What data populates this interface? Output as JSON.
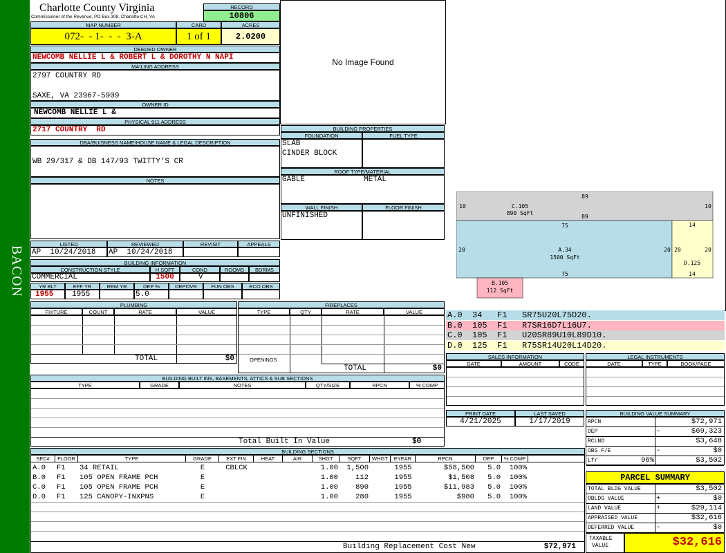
{
  "sidebar": {
    "text": "BACON"
  },
  "header": {
    "county": "Charlotte County Virginia",
    "commissioner": "Commissioner of the Revenue, PO Box 308, Charlotte CH, VA",
    "record_label": "RECORD",
    "record": "10806"
  },
  "parcel": {
    "map_label": "MAP NUMBER",
    "map": "072-  - 1-  -  -  3-A",
    "card_label": "CARD",
    "card": "1 of 1",
    "acres_label": "ACRES",
    "acres": "2.0200"
  },
  "owner": {
    "deeded_label": "DEEDED OWNER",
    "deeded": "NEWCOMB NELLIE L & ROBERT L & DOROTHY N NAPI",
    "mailing_label": "MAILING ADDRESS",
    "mailing1": "2797 COUNTRY RD",
    "mailing2": "SAXE, VA 23967-5909",
    "ownerid_label": "OWNER ID",
    "ownerid": "NEWCOMB NELLIE L &",
    "physical_label": "PHYSICAL 911 ADDRESS",
    "physical": "2717 COUNTRY  RD",
    "dba_label": "DBA/BUISNESS NAME/HOUSE NAME & LEGAL DESCRIPTION",
    "dba": "WB 29/317 & DB 147/93 TWITTY'S CR",
    "notes_label": "NOTES"
  },
  "image": {
    "text": "No Image Found"
  },
  "bldg_props": {
    "title": "BUILDING PROPERTIES",
    "foundation_label": "FOUNDATION",
    "foundation1": "SLAB",
    "foundation2": "CINDER BLOCK",
    "fuel_label": "FUEL TYPE",
    "roof_label": "ROOF TYPE/MATERIAL",
    "roof_type": "GABLE",
    "roof_material": "METAL",
    "wall_label": "WALL FINISH",
    "wall": "UNFINISHED",
    "floor_label": "FLOOR FINISH"
  },
  "review": {
    "listed_label": "LISTED",
    "listed_by": "AP",
    "listed": "10/24/2018",
    "reviewed_label": "REVIEWED",
    "reviewed_by": "AP",
    "reviewed": "10/24/2018",
    "revisit_label": "REVISIT",
    "appeals_label": "APPEALS"
  },
  "bldg_info": {
    "title": "BUILDING INFORMATION",
    "style_label": "CONSTRUCTION STYLE",
    "style": "COMMERCIAL",
    "hsqft_label": "H SQFT",
    "hsqft": "1500",
    "cond_label": "COND",
    "cond": "V",
    "rooms_label": "ROOMS",
    "bdrms_label": "BDRMS",
    "yrblt_label": "YR BLT",
    "yrblt": "1955",
    "effyr_label": "EFF YR",
    "effyr": "1955",
    "remyr_label": "REM YR",
    "dep_label": "DEP %",
    "dep": "5.0",
    "depovr_label": "DEPOVR",
    "funobs_label": "FUN OBS",
    "ecoobs_label": "ECO OBS"
  },
  "plumbing": {
    "title": "PLUMBING",
    "cols": [
      "FIXTURE",
      "COUNT",
      "RATE",
      "VALUE"
    ],
    "total_label": "TOTAL",
    "total": "$0"
  },
  "fireplaces": {
    "title": "FIREPLACES",
    "cols": [
      "TYPE",
      "QTY",
      "RATE",
      "VALUE"
    ],
    "openings_label": "OPENINGS",
    "total_label": "TOTAL",
    "total": "$0"
  },
  "builtins": {
    "title": "BUILDING BUILT INS, BASEMENTS, ATTICS & SUB SECTIONS",
    "cols": [
      "TYPE",
      "GRADE",
      "NOTES",
      "QTY/SIZE",
      "RPCN",
      "% COMP"
    ],
    "total_label": "Total Built In Value",
    "total": "$0"
  },
  "sections": {
    "title": "BUILDING SECTIONS",
    "cols": [
      "SEC#",
      "FLOOR",
      "TYPE",
      "GRADE",
      "EXT FIN",
      "HEAT",
      "AIR",
      "SHGT",
      "SQFT",
      "WHGT",
      "EYEAR",
      "RPCN",
      "DEP",
      "% COMP"
    ],
    "rows": [
      {
        "sec": "A.0",
        "floor": "F1",
        "type": "34 RETAIL",
        "grade": "E",
        "ext": "CBLCK",
        "shgt": "1.00",
        "sqft": "1,500",
        "eyear": "1955",
        "rpcn": "$58,500",
        "dep": "5.0",
        "comp": "100%"
      },
      {
        "sec": "B.0",
        "floor": "F1",
        "type": "105 OPEN FRAME PCH",
        "grade": "E",
        "ext": "",
        "shgt": "1.00",
        "sqft": "112",
        "eyear": "1955",
        "rpcn": "$1,508",
        "dep": "5.0",
        "comp": "100%"
      },
      {
        "sec": "C.0",
        "floor": "F1",
        "type": "105 OPEN FRAME PCH",
        "grade": "E",
        "ext": "",
        "shgt": "1.00",
        "sqft": "890",
        "eyear": "1955",
        "rpcn": "$11,983",
        "dep": "5.0",
        "comp": "100%"
      },
      {
        "sec": "D.0",
        "floor": "F1",
        "type": "125 CANOPY-INXPNS",
        "grade": "E",
        "ext": "",
        "shgt": "1.00",
        "sqft": "280",
        "eyear": "1955",
        "rpcn": "$980",
        "dep": "5.0",
        "comp": "100%"
      }
    ],
    "brcn_label": "Building Replacement Cost New",
    "brcn": "$72,971"
  },
  "sketch": {
    "c_label": "C.105",
    "c_area": "890 SqFt",
    "a_label": "A.34",
    "a_area": "1500 SqFt",
    "d_label": "D.125",
    "b_label": "B.105",
    "b_area": "112 SqFt",
    "dims": {
      "c_top": "89",
      "c_bottom": "89",
      "c_left": "10",
      "c_right": "10",
      "a_top": "75",
      "a_bottom": "75",
      "a_left": "20",
      "a_right": "20",
      "d_top": "14",
      "d_bottom": "14",
      "d_left": "20",
      "d_right": "20"
    },
    "codes": [
      {
        "text": "A.0  34   F1   SR75U20L75D20.",
        "color": "#b7dde8"
      },
      {
        "text": "B.0  105  F1   R7SR16D7L16U7.",
        "color": "#ffb6c1"
      },
      {
        "text": "C.0  105  F1   U20SR89U10L89D10.",
        "color": "#d3d3d3"
      },
      {
        "text": "D.0  125  F1   R75SR14U20L14D20.",
        "color": "#ffffcc"
      }
    ]
  },
  "sales": {
    "title": "SALES INFORMATION",
    "cols": [
      "DATE",
      "AMOUNT",
      "CODE"
    ]
  },
  "legal": {
    "title": "LEGAL INSTRUMENTS",
    "cols": [
      "DATE",
      "TYPE",
      "BOOK/PAGE"
    ]
  },
  "dates": {
    "print_label": "PRINT DATE",
    "print": "4/21/2025",
    "saved_label": "LAST SAVED",
    "saved": "1/17/2019"
  },
  "value_summary": {
    "title": "BUILDING VALUE SUMMARY",
    "rows": [
      {
        "label": "RPCN",
        "sign": "",
        "value": "$72,971"
      },
      {
        "label": "DEP",
        "sign": "-",
        "value": "$69,323"
      },
      {
        "label": "RCLND",
        "sign": "",
        "value": "$3,648"
      },
      {
        "label": "OBS F/E",
        "sign": "-",
        "value": "$0"
      },
      {
        "label": "Lfr",
        "pct": "96%",
        "sign": "",
        "value": "$3,502"
      }
    ]
  },
  "parcel_summary": {
    "title": "PARCEL SUMMARY",
    "rows": [
      {
        "label": "TOTAL BLDG VALUE",
        "sign": "",
        "value": "$3,502"
      },
      {
        "label": "OBLDG VALUE",
        "sign": "+",
        "value": "$0"
      },
      {
        "label": "LAND VALUE",
        "sign": "+",
        "value": "$29,114"
      },
      {
        "label": "APPRAISED VALUE",
        "sign": "",
        "value": "$32,616"
      },
      {
        "label": "DEFERRED VALUE",
        "sign": "-",
        "value": "$0"
      }
    ],
    "taxable_label1": "TAXABLE",
    "taxable_label2": "VALUE",
    "taxable": "$32,616"
  }
}
